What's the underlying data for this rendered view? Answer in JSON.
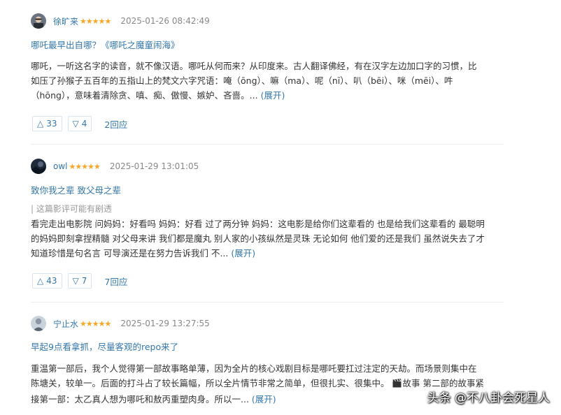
{
  "reviews": [
    {
      "username": "徐旷来",
      "stars": "★★★★★",
      "time": "2025-01-26 08:42:49",
      "title": "哪吒最早出自哪？《哪吒之魔童闹海》",
      "content_lines": [
        "哪吒，一听这名字的读音，就不像汉语。哪吒从何而来？从印度来。古人翻译佛经，有在汉字左边加口字的习惯，比",
        "如压了孙猴子五百年的五指山上的梵文六字咒语：唵（ōng）、嘛（ma）、呢（nī）、叭（bēi）、咪（mēi）、吽",
        "（hōng），意味着清除贪、嗔、痴、傲慢、嫉妒、吝啬。... "
      ],
      "expand": "(展开)",
      "up_count": "33",
      "down_count": "4",
      "replies": "2回应"
    },
    {
      "username": "owl",
      "stars": "★★★★★",
      "time": "2025-01-29 13:01:05",
      "title": "致你我之辈 致父母之辈",
      "spoiler": "| 这篇影评可能有剧透",
      "content_lines": [
        "看完走出电影院 问妈妈：好看吗 妈妈：好看 过了两分钟 妈妈：这电影是给你们这辈看的 也是给我们这辈看的 最聪明",
        "的妈妈即刻拿捏精髓 对父母来讲 我们都是魔丸 别人家的小孩纵然是灵珠 无论如何 他们爱的还是我们 虽然说失去了才",
        "知道珍惜是句名言 可导演还是在努力告诉我们 不... "
      ],
      "expand": "(展开)",
      "up_count": "43",
      "down_count": "7",
      "replies": "7回应"
    },
    {
      "username": "宁止水",
      "stars": "★★★★★",
      "time": "2025-01-29 13:27:55",
      "title": "早起9点看拿抓，尽量客观的repo来了",
      "content_lines": [
        "重温第一部后，我个人觉得第一部故事略单薄，因为全片的核心戏剧目标是哪吒要扛过注定的天劫。而场景则集中在",
        "陈塘关，较单一。后面的打斗占了较长篇幅，所以全片情节非常之简单，但很扎实、很集中。",
        "故事 第二部的故事紧",
        "接第一部：太乙真人想为哪吒和敖丙重塑肉身。所以一... "
      ],
      "expand": "(展开)"
    }
  ],
  "watermark": "头条 @不八卦会死星人",
  "colors": {
    "link": "#3377aa",
    "star": "#f5a623",
    "meta": "#888888"
  }
}
